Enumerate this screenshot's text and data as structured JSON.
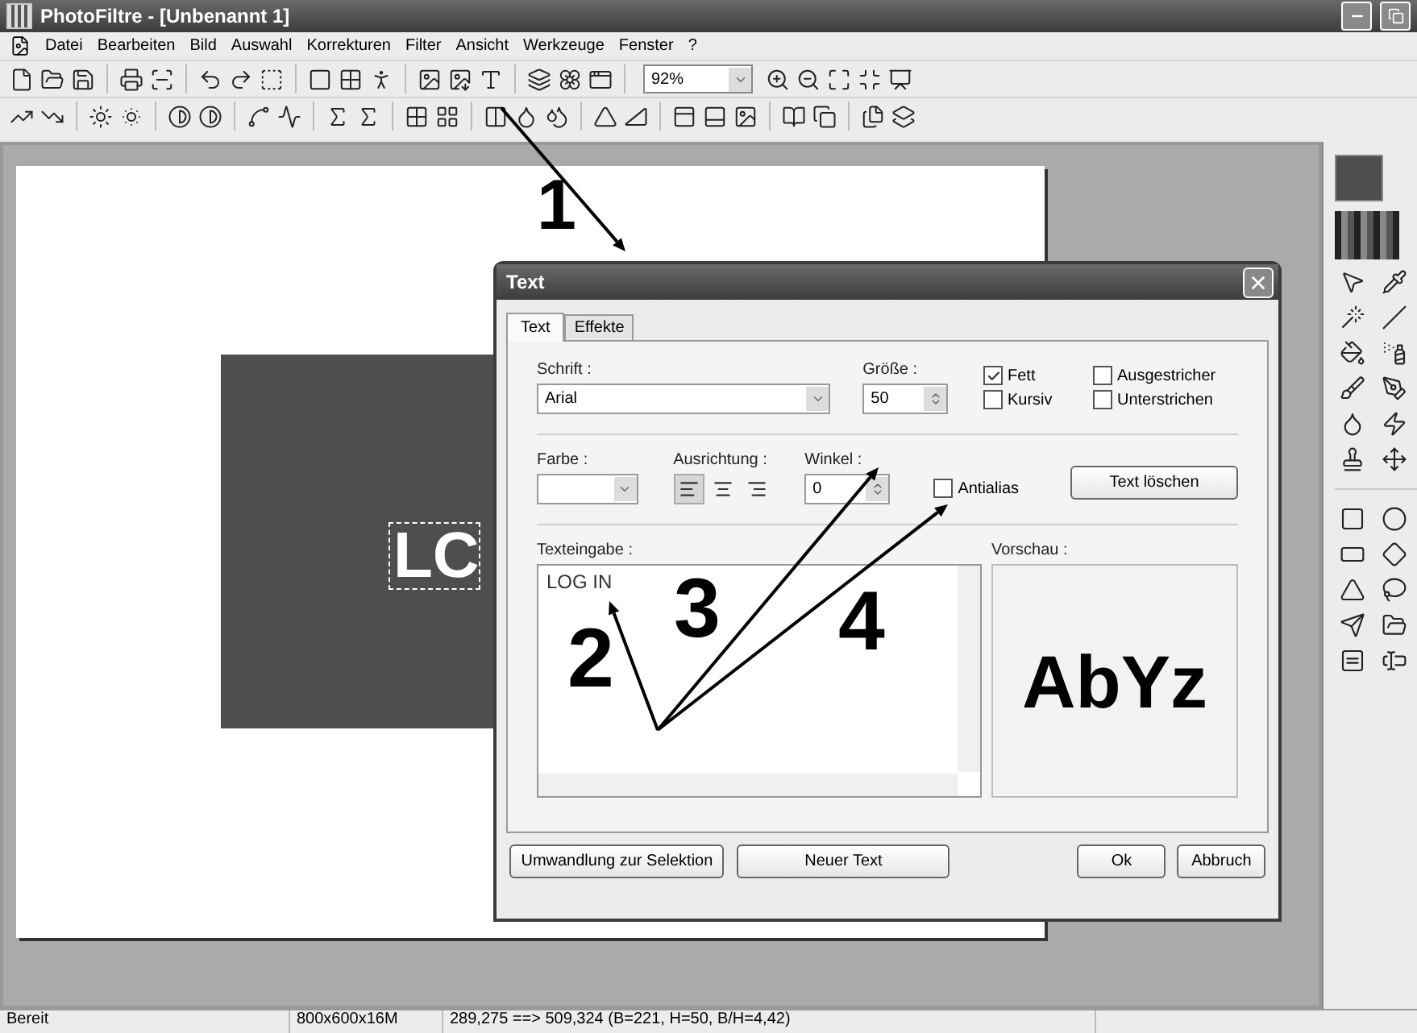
{
  "window": {
    "title": "PhotoFiltre - [Unbenannt 1]"
  },
  "menu": [
    "Datei",
    "Bearbeiten",
    "Bild",
    "Auswahl",
    "Korrekturen",
    "Filter",
    "Ansicht",
    "Werkzeuge",
    "Fenster",
    "?"
  ],
  "zoom_select": {
    "value": "92%"
  },
  "canvas": {
    "text": "LC"
  },
  "dialog": {
    "title": "Text",
    "tabs": [
      {
        "label": "Text",
        "selected": true
      },
      {
        "label": "Effekte",
        "selected": false
      }
    ],
    "font": {
      "label": "Schrift :",
      "value": "Arial"
    },
    "size": {
      "label": "Größe :",
      "value": "50"
    },
    "styles": [
      {
        "label": "Fett",
        "checked": true
      },
      {
        "label": "Ausgestricher",
        "checked": false
      },
      {
        "label": "Kursiv",
        "checked": false
      },
      {
        "label": "Unterstrichen",
        "checked": false
      }
    ],
    "color": {
      "label": "Farbe :"
    },
    "alignment": {
      "label": "Ausrichtung :",
      "options": [
        {
          "kind": "left",
          "selected": true
        },
        {
          "kind": "center",
          "selected": false
        },
        {
          "kind": "right",
          "selected": false
        }
      ]
    },
    "angle": {
      "label": "Winkel :",
      "value": "0"
    },
    "antialias": {
      "label": "Antialias",
      "checked": false
    },
    "clear_button": "Text löschen",
    "text_input": {
      "label": "Texteingabe :",
      "value": "LOG IN"
    },
    "preview": {
      "label": "Vorschau :",
      "sample": "AbYz"
    },
    "buttons": [
      "Umwandlung zur Selektion",
      "Neuer Text",
      "Ok",
      "Abbruch"
    ]
  },
  "annotations": [
    {
      "label": "1"
    },
    {
      "label": "2"
    },
    {
      "label": "3"
    },
    {
      "label": "4"
    }
  ],
  "status_bar": [
    "Bereit",
    "800x600x16M",
    "289,275 ==> 509,324 (B=221, H=50, B/H=4,42)"
  ]
}
